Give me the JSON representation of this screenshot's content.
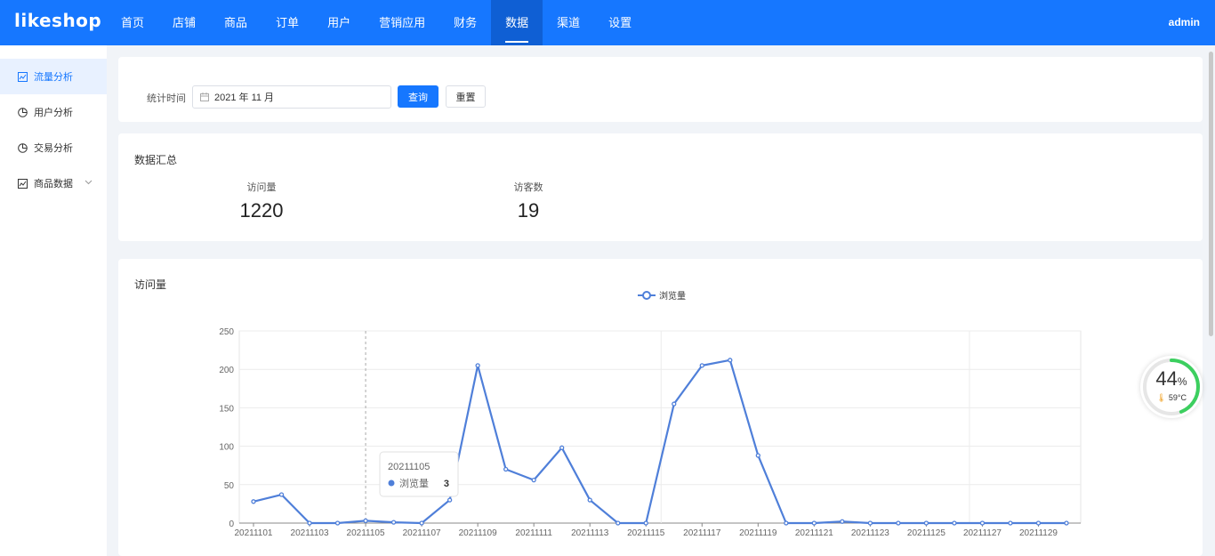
{
  "header": {
    "logo": "likeshop",
    "nav": [
      {
        "label": "首页"
      },
      {
        "label": "店铺"
      },
      {
        "label": "商品"
      },
      {
        "label": "订单"
      },
      {
        "label": "用户"
      },
      {
        "label": "营销应用"
      },
      {
        "label": "财务"
      },
      {
        "label": "数据",
        "active": true
      },
      {
        "label": "渠道"
      },
      {
        "label": "设置"
      }
    ],
    "user": "admin"
  },
  "sidebar": {
    "items": [
      {
        "label": "流量分析",
        "icon": "chart-icon",
        "active": true
      },
      {
        "label": "用户分析",
        "icon": "pie-icon"
      },
      {
        "label": "交易分析",
        "icon": "pie-icon"
      },
      {
        "label": "商品数据",
        "icon": "chart-icon",
        "expandable": true
      }
    ]
  },
  "filter": {
    "label": "统计时间",
    "date_value": "2021 年 11 月",
    "query_button": "查询",
    "reset_button": "重置"
  },
  "summary": {
    "title": "数据汇总",
    "stats": [
      {
        "label": "访问量",
        "value": "1220"
      },
      {
        "label": "访客数",
        "value": "19"
      }
    ]
  },
  "chart_section": {
    "title": "访问量"
  },
  "chart_data": {
    "type": "line",
    "title": "",
    "xlabel": "",
    "ylabel": "",
    "ylim": [
      0,
      250
    ],
    "yticks": [
      0,
      50,
      100,
      150,
      200,
      250
    ],
    "x": [
      "20211101",
      "20211102",
      "20211103",
      "20211104",
      "20211105",
      "20211106",
      "20211107",
      "20211108",
      "20211109",
      "20211110",
      "20211111",
      "20211112",
      "20211113",
      "20211114",
      "20211115",
      "20211116",
      "20211117",
      "20211118",
      "20211119",
      "20211120",
      "20211121",
      "20211122",
      "20211123",
      "20211124",
      "20211125",
      "20211126",
      "20211127",
      "20211128",
      "20211129",
      "20211130"
    ],
    "x_tick_labels": [
      "20211101",
      "20211103",
      "20211105",
      "20211107",
      "20211109",
      "20211111",
      "20211113",
      "20211115",
      "20211117",
      "20211119",
      "20211121",
      "20211123",
      "20211125",
      "20211127",
      "20211129"
    ],
    "series": [
      {
        "name": "浏览量",
        "color": "#4f7fd9",
        "values": [
          28,
          37,
          0,
          0,
          3,
          1,
          0,
          30,
          205,
          70,
          56,
          98,
          30,
          0,
          0,
          155,
          205,
          212,
          88,
          0,
          0,
          2,
          0,
          0,
          0,
          0,
          0,
          0,
          0,
          0
        ]
      }
    ],
    "legend_position": "top-center",
    "grid": true,
    "tooltip": {
      "date": "20211105",
      "series": "浏览量",
      "value": "3"
    }
  },
  "widget": {
    "percent": "44",
    "percent_unit": "%",
    "temperature": "59°C",
    "ring_fraction": 0.44
  },
  "colors": {
    "primary": "#1677ff",
    "line": "#4f7fd9",
    "gauge": "#3ccf5f"
  }
}
